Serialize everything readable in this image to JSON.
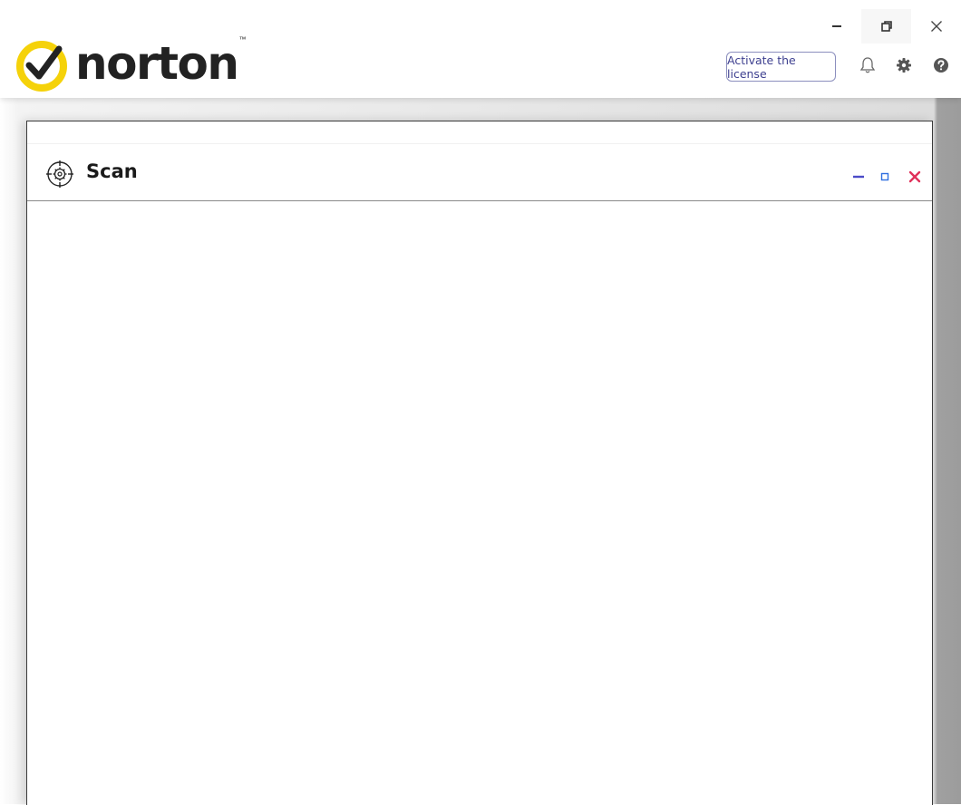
{
  "app": {
    "brand": "norton",
    "trademark": "™",
    "brand_color": "#f5d20a"
  },
  "header": {
    "activate_label": "Activate the license",
    "icons": [
      "bell-icon",
      "gear-icon",
      "help-icon"
    ]
  },
  "window_controls": [
    "minimize-icon",
    "restore-icon",
    "close-icon"
  ],
  "dialog": {
    "title": "Scan",
    "icon": "scan-target-icon",
    "controls": {
      "minimize_color": "#4b4bc8",
      "maximize_color": "#2f6fe0",
      "close_color": "#e0315a"
    }
  }
}
